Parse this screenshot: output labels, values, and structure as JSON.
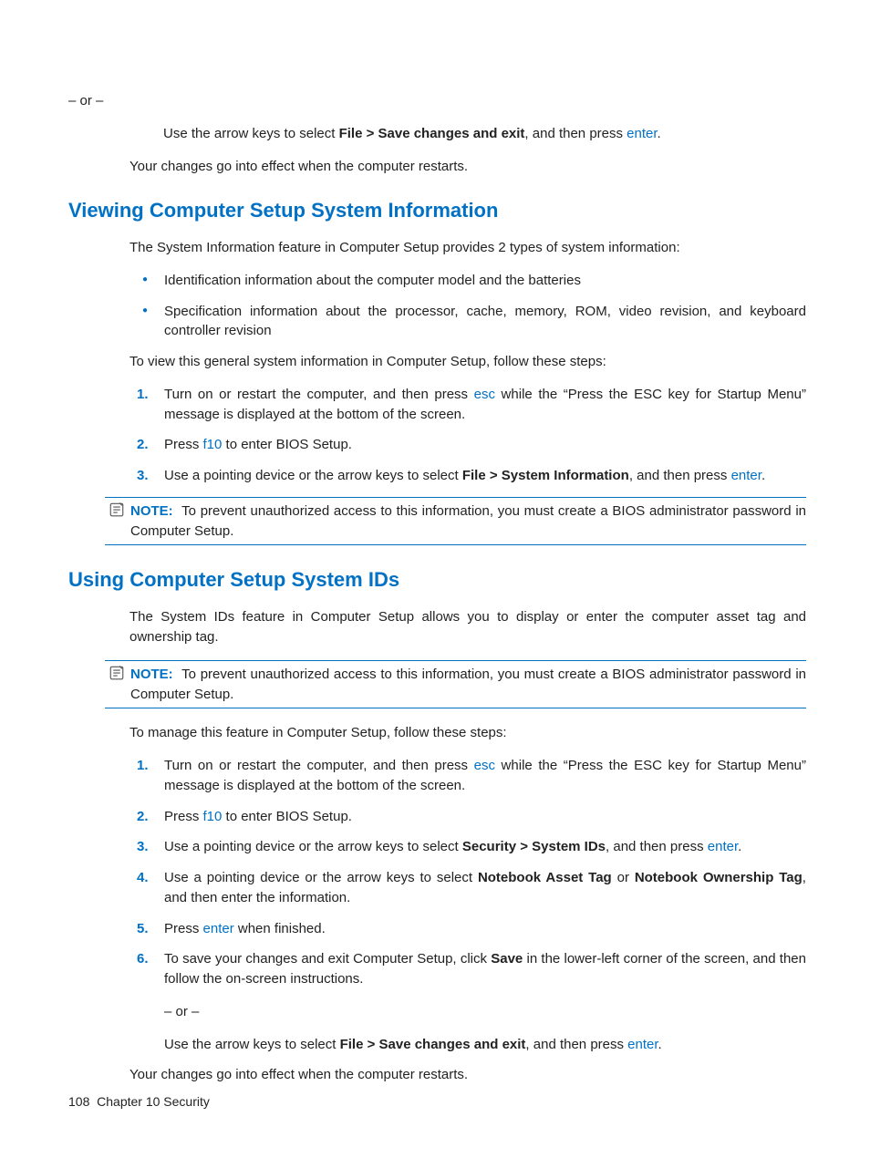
{
  "prelude": {
    "or": "– or –",
    "use_arrows_pre": "Use the arrow keys to select ",
    "file_save": "File > Save changes and exit",
    "use_arrows_post": ", and then press ",
    "enter": "enter",
    "period": ".",
    "restart": "Your changes go into effect when the computer restarts."
  },
  "section1": {
    "heading": "Viewing Computer Setup System Information",
    "intro": "The System Information feature in Computer Setup provides 2 types of system information:",
    "bullet1": "Identification information about the computer model and the batteries",
    "bullet2": "Specification information about the processor, cache, memory, ROM, video revision, and keyboard controller revision",
    "follow": "To view this general system information in Computer Setup, follow these steps:",
    "step1a": "Turn on or restart the computer, and then press ",
    "esc": "esc",
    "step1b": " while the “Press the ESC key for Startup Menu” message is displayed at the bottom of the screen.",
    "step2a": "Press ",
    "f10": "f10",
    "step2b": " to enter BIOS Setup.",
    "step3a": "Use a pointing device or the arrow keys to select ",
    "file_sysinfo": "File > System Information",
    "step3b": ", and then press ",
    "note_label": "NOTE:",
    "note_body": "To prevent unauthorized access to this information, you must create a BIOS administrator password in Computer Setup."
  },
  "section2": {
    "heading": "Using Computer Setup System IDs",
    "intro": "The System IDs feature in Computer Setup allows you to display or enter the computer asset tag and ownership tag.",
    "note_label": "NOTE:",
    "note_body": "To prevent unauthorized access to this information, you must create a BIOS administrator password in Computer Setup.",
    "follow": "To manage this feature in Computer Setup, follow these steps:",
    "step1a": "Turn on or restart the computer, and then press ",
    "esc": "esc",
    "step1b": " while the “Press the ESC key for Startup Menu” message is displayed at the bottom of the screen.",
    "step2a": "Press ",
    "f10": "f10",
    "step2b": " to enter BIOS Setup.",
    "step3a": "Use a pointing device or the arrow keys to select ",
    "sec_sysids": "Security > System IDs",
    "step3b": ", and then press ",
    "step4a": "Use a pointing device or the arrow keys to select ",
    "asset_tag": "Notebook Asset Tag",
    "or_word": " or ",
    "own_tag": "Notebook Ownership Tag",
    "step4b": ", and then enter the information.",
    "step5a": "Press ",
    "step5b": " when finished.",
    "step6a": "To save your changes and exit Computer Setup, click ",
    "save": "Save",
    "step6b": " in the lower-left corner of the screen, and then follow the on-screen instructions.",
    "or": "– or –",
    "use_arrows_pre": "Use the arrow keys to select ",
    "file_save": "File > Save changes and exit",
    "use_arrows_post": ", and then press ",
    "restart": "Your changes go into effect when the computer restarts."
  },
  "footer": {
    "pagenum": "108",
    "chapter": "Chapter 10   Security"
  },
  "keys": {
    "enter": "enter",
    "period": "."
  }
}
